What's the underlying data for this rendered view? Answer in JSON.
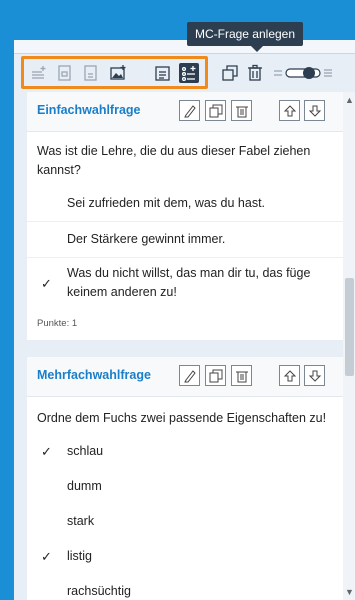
{
  "tooltip": "MC-Frage anlegen",
  "toolbar": {
    "icons": [
      "add-text-icon",
      "add-gap-icon",
      "add-page-icon",
      "add-image-icon",
      "add-article-icon",
      "add-mc-icon",
      "copy-icon",
      "trash-icon",
      "toggle-switch",
      "more-icon"
    ]
  },
  "cards": [
    {
      "title": "Einfachwahlfrage",
      "question": "Was ist die Lehre, die du aus dieser Fabel ziehen kannst?",
      "options": [
        {
          "text": "Sei zufrieden mit dem, was du hast.",
          "correct": false
        },
        {
          "text": "Der Stärkere gewinnt immer.",
          "correct": false
        },
        {
          "text": "Was du nicht willst, das man dir tu, das füge keinem anderen zu!",
          "correct": true
        }
      ],
      "points": "Punkte: 1"
    },
    {
      "title": "Mehrfachwahlfrage",
      "question": "Ordne dem Fuchs zwei passende Eigenschaften zu!",
      "options": [
        {
          "text": "schlau",
          "correct": true
        },
        {
          "text": "dumm",
          "correct": false
        },
        {
          "text": "stark",
          "correct": false
        },
        {
          "text": "listig",
          "correct": true
        },
        {
          "text": "rachsüchtig",
          "correct": false
        }
      ]
    }
  ],
  "check_mark": "✓",
  "scroll": {
    "up": "▲",
    "down": "▼"
  }
}
